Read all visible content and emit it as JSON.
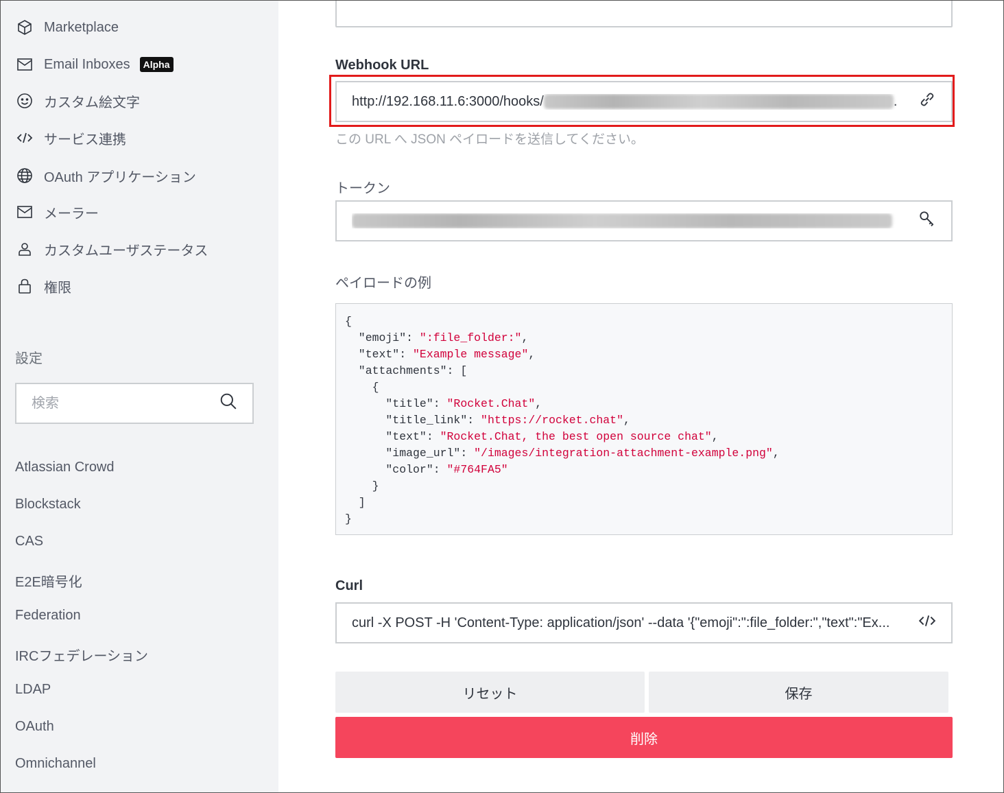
{
  "sidebar": {
    "nav_items": [
      {
        "label": "Marketplace",
        "icon": "cube-icon"
      },
      {
        "label": "Email Inboxes",
        "icon": "mail-icon",
        "badge": "Alpha"
      },
      {
        "label": "カスタム絵文字",
        "icon": "emoji-icon"
      },
      {
        "label": "サービス連携",
        "icon": "code-icon"
      },
      {
        "label": "OAuth アプリケーション",
        "icon": "globe-icon"
      },
      {
        "label": "メーラー",
        "icon": "mail-icon"
      },
      {
        "label": "カスタムユーザステータス",
        "icon": "user-icon"
      },
      {
        "label": "権限",
        "icon": "lock-icon"
      }
    ],
    "settings_label": "設定",
    "search_placeholder": "検索",
    "settings_items": [
      "Atlassian Crowd",
      "Blockstack",
      "CAS",
      "E2E暗号化",
      "Federation",
      "IRCフェデレーション",
      "LDAP",
      "OAuth",
      "Omnichannel"
    ]
  },
  "main": {
    "webhook": {
      "label": "Webhook URL",
      "value": "http://192.168.11.6:3000/hooks/",
      "hint": "この URL へ JSON ペイロードを送信してください。"
    },
    "token": {
      "label": "トークン"
    },
    "payload": {
      "label": "ペイロードの例",
      "lines": [
        [
          [
            "k",
            "{"
          ]
        ],
        [
          [
            "k",
            "  \"emoji\": "
          ],
          [
            "s",
            "\":file_folder:\""
          ],
          [
            "k",
            ","
          ]
        ],
        [
          [
            "k",
            "  \"text\": "
          ],
          [
            "s",
            "\"Example message\""
          ],
          [
            "k",
            ","
          ]
        ],
        [
          [
            "k",
            "  \"attachments\": ["
          ]
        ],
        [
          [
            "k",
            "    {"
          ]
        ],
        [
          [
            "k",
            "      \"title\": "
          ],
          [
            "s",
            "\"Rocket.Chat\""
          ],
          [
            "k",
            ","
          ]
        ],
        [
          [
            "k",
            "      \"title_link\": "
          ],
          [
            "s",
            "\"https://rocket.chat\""
          ],
          [
            "k",
            ","
          ]
        ],
        [
          [
            "k",
            "      \"text\": "
          ],
          [
            "s",
            "\"Rocket.Chat, the best open source chat\""
          ],
          [
            "k",
            ","
          ]
        ],
        [
          [
            "k",
            "      \"image_url\": "
          ],
          [
            "s",
            "\"/images/integration-attachment-example.png\""
          ],
          [
            "k",
            ","
          ]
        ],
        [
          [
            "k",
            "      \"color\": "
          ],
          [
            "s",
            "\"#764FA5\""
          ]
        ],
        [
          [
            "k",
            "    }"
          ]
        ],
        [
          [
            "k",
            "  ]"
          ]
        ],
        [
          [
            "k",
            "}"
          ]
        ]
      ]
    },
    "curl": {
      "label": "Curl",
      "value": "curl -X POST -H 'Content-Type: application/json' --data '{\"emoji\":\":file_folder:\",\"text\":\"Ex..."
    },
    "buttons": {
      "reset": "リセット",
      "save": "保存",
      "delete": "削除"
    }
  },
  "colors": {
    "danger": "#f5455c",
    "highlight": "#e21b1b",
    "code_string": "#d1003a"
  }
}
